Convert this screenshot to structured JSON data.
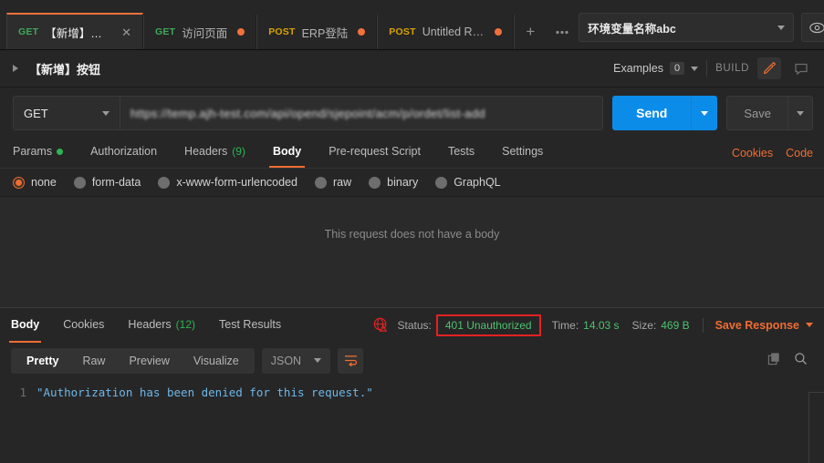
{
  "tabs": [
    {
      "method": "GET",
      "name": "【新增】按钮",
      "active": true,
      "unsaved": false,
      "closable": true
    },
    {
      "method": "GET",
      "name": "访问页面",
      "active": false,
      "unsaved": true,
      "closable": false
    },
    {
      "method": "POST",
      "name": "ERP登陆",
      "active": false,
      "unsaved": true,
      "closable": false
    },
    {
      "method": "POST",
      "name": "Untitled Re...",
      "active": false,
      "unsaved": true,
      "closable": false
    }
  ],
  "tabbar": {
    "new_tab_label": "+",
    "more_label": "●●●"
  },
  "environment": {
    "selected": "环境变量名称abc",
    "eye_icon": "eye-icon",
    "settings_icon": "sliders-icon"
  },
  "request_header": {
    "name": "【新增】按钮",
    "expand_icon": "chevron-right-icon",
    "examples_label": "Examples",
    "examples_count": "0",
    "build_label": "BUILD",
    "edit_icon": "pencil-icon",
    "comment_icon": "comment-icon"
  },
  "url_bar": {
    "method": "GET",
    "url": "https://temp.ajh-test.com/api/opend/sjepoint/acm/p/ordet/list-add",
    "send_label": "Send",
    "save_label": "Save"
  },
  "request_tabs": [
    {
      "label": "Params",
      "active": false,
      "dot": true,
      "count": ""
    },
    {
      "label": "Authorization",
      "active": false,
      "dot": false,
      "count": ""
    },
    {
      "label": "Headers",
      "active": false,
      "dot": false,
      "count": "(9)"
    },
    {
      "label": "Body",
      "active": true,
      "dot": false,
      "count": ""
    },
    {
      "label": "Pre-request Script",
      "active": false,
      "dot": false,
      "count": ""
    },
    {
      "label": "Tests",
      "active": false,
      "dot": false,
      "count": ""
    },
    {
      "label": "Settings",
      "active": false,
      "dot": false,
      "count": ""
    }
  ],
  "request_tabs_right": {
    "cookies": "Cookies",
    "code": "Code"
  },
  "body_types": [
    {
      "label": "none",
      "selected": true
    },
    {
      "label": "form-data",
      "selected": false
    },
    {
      "label": "x-www-form-urlencoded",
      "selected": false
    },
    {
      "label": "raw",
      "selected": false
    },
    {
      "label": "binary",
      "selected": false
    },
    {
      "label": "GraphQL",
      "selected": false
    }
  ],
  "body_placeholder": "This request does not have a body",
  "response_tabs": [
    {
      "label": "Body",
      "active": true,
      "count": ""
    },
    {
      "label": "Cookies",
      "active": false,
      "count": ""
    },
    {
      "label": "Headers",
      "active": false,
      "count": "(12)"
    },
    {
      "label": "Test Results",
      "active": false,
      "count": ""
    }
  ],
  "response_meta": {
    "warning_icon": "globe-warning-icon",
    "status_label": "Status:",
    "status_value": "401 Unauthorized",
    "status_highlight_color": "#e32222",
    "time_label": "Time:",
    "time_value": "14.03 s",
    "size_label": "Size:",
    "size_value": "469 B",
    "save_response_label": "Save Response"
  },
  "response_view": {
    "modes": [
      {
        "label": "Pretty",
        "active": true
      },
      {
        "label": "Raw",
        "active": false
      },
      {
        "label": "Preview",
        "active": false
      },
      {
        "label": "Visualize",
        "active": false
      }
    ],
    "format": "JSON",
    "wrap_icon": "wrap-lines-icon",
    "copy_icon": "copy-icon",
    "search_icon": "search-icon"
  },
  "response_body": {
    "lines": [
      {
        "number": "1",
        "text": "\"Authorization has been denied for this request.\""
      }
    ]
  },
  "colors": {
    "accent_orange": "#ef6c33",
    "send_blue": "#0c8ce9",
    "get_green": "#3da95a",
    "post_yellow": "#d8a302",
    "status_green": "#4ec16f",
    "annotation_red": "#e32222"
  }
}
